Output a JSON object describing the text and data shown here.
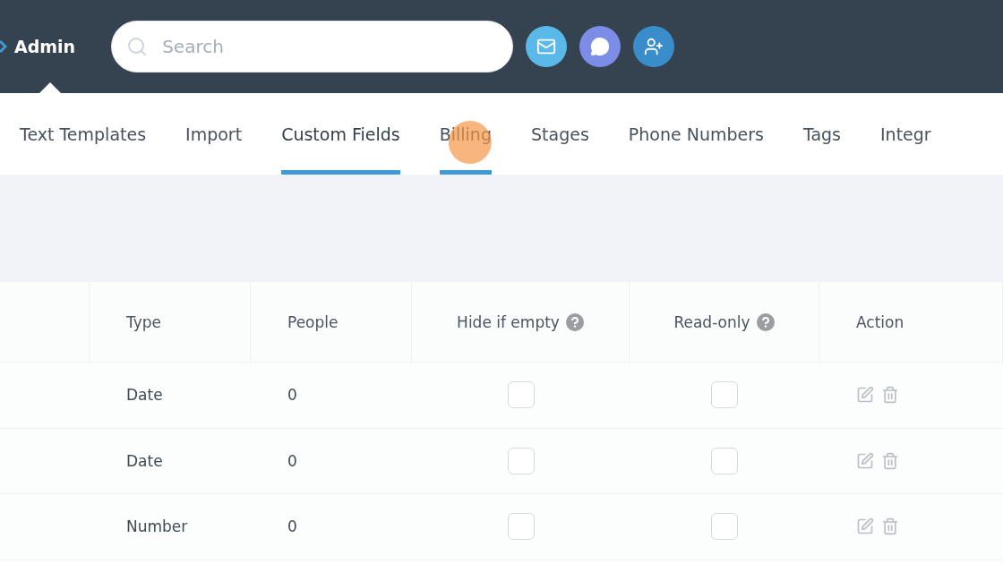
{
  "header": {
    "title": "Admin",
    "search": {
      "placeholder": "Search"
    }
  },
  "tabs": [
    {
      "label": "Text Templates",
      "selected": false,
      "hovered": false
    },
    {
      "label": "Import",
      "selected": false,
      "hovered": false
    },
    {
      "label": "Custom Fields",
      "selected": true,
      "hovered": false
    },
    {
      "label": "Billing",
      "selected": false,
      "hovered": true
    },
    {
      "label": "Stages",
      "selected": false,
      "hovered": false
    },
    {
      "label": "Phone Numbers",
      "selected": false,
      "hovered": false
    },
    {
      "label": "Tags",
      "selected": false,
      "hovered": false
    },
    {
      "label": "Integr",
      "selected": false,
      "hovered": false
    }
  ],
  "table": {
    "columns": [
      {
        "label": "Type",
        "help": false
      },
      {
        "label": "People",
        "help": false
      },
      {
        "label": "Hide if empty",
        "help": true
      },
      {
        "label": "Read-only",
        "help": true
      },
      {
        "label": "Action",
        "help": false
      }
    ],
    "rows": [
      {
        "type": "Date",
        "people": "0",
        "hide_if_empty": false,
        "read_only": false
      },
      {
        "type": "Date",
        "people": "0",
        "hide_if_empty": false,
        "read_only": false
      },
      {
        "type": "Number",
        "people": "0",
        "hide_if_empty": false,
        "read_only": false
      }
    ]
  }
}
